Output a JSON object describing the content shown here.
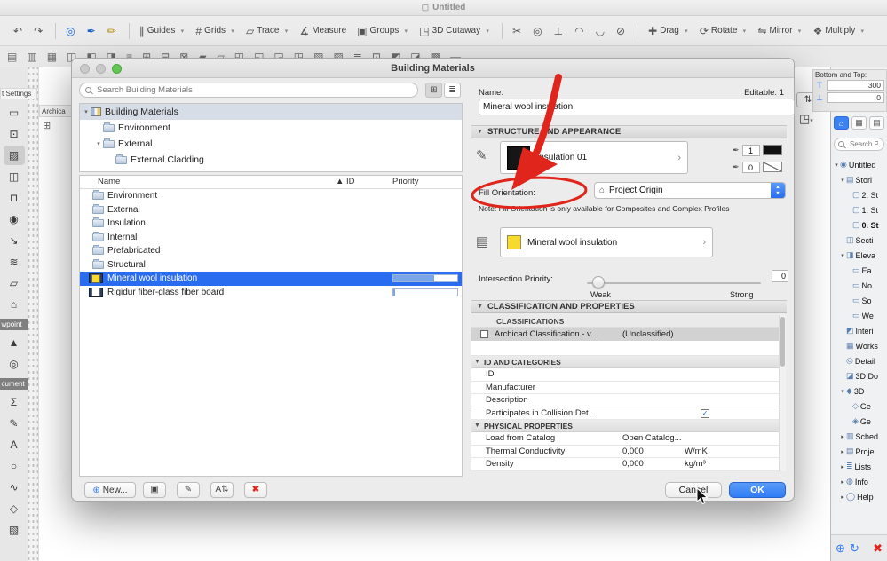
{
  "screen": {
    "title": "Untitled",
    "title_icon": "▢"
  },
  "toolbar1": {
    "items": [
      {
        "glyph": "↶",
        "name": "undo"
      },
      {
        "glyph": "↷",
        "name": "redo"
      },
      {
        "sep": true
      },
      {
        "glyph": "◎",
        "name": "pick-up-parameters",
        "color": "#1b66c9"
      },
      {
        "glyph": "✒",
        "name": "inject-parameters",
        "color": "#1b66c9"
      },
      {
        "glyph": "✏",
        "name": "favorites-pen",
        "color": "#b8920f"
      },
      {
        "sep": true
      },
      {
        "glyph": "∥",
        "label": "Guides",
        "chev": "▾"
      },
      {
        "glyph": "#",
        "label": "Grids",
        "chev": "▾"
      },
      {
        "glyph": "▱",
        "label": "Trace",
        "chev": "▾"
      },
      {
        "glyph": "∡",
        "label": "Measure"
      },
      {
        "glyph": "▣",
        "label": "Groups",
        "chev": "▾"
      },
      {
        "glyph": "◳",
        "label": "3D Cutaway",
        "chev": "▾"
      },
      {
        "sep": true
      },
      {
        "glyph": "✂",
        "name": "split"
      },
      {
        "glyph": "◎",
        "name": "adjust"
      },
      {
        "glyph": "⊥",
        "name": "intersect"
      },
      {
        "glyph": "◠",
        "name": "fillet"
      },
      {
        "glyph": "◡",
        "name": "chamfer"
      },
      {
        "glyph": "⊘",
        "name": "trim"
      },
      {
        "sep": true
      },
      {
        "glyph": "✚",
        "label": "Drag",
        "chev": "▾"
      },
      {
        "glyph": "⟳",
        "label": "Rotate",
        "chev": "▾"
      },
      {
        "glyph": "⇋",
        "label": "Mirror",
        "chev": "▾"
      },
      {
        "glyph": "❖",
        "label": "Multiply",
        "chev": "▾"
      }
    ]
  },
  "toolbar2": {
    "icons": [
      "▤",
      "▥",
      "▦",
      "◫",
      "◧",
      "◨",
      "≡",
      "⊞",
      "⊟",
      "⊠",
      "▰",
      "▱",
      "◰",
      "◱",
      "◲",
      "◳",
      "▧",
      "▨",
      "≣",
      "⊡",
      "◩",
      "◪",
      "▩",
      "▬"
    ]
  },
  "left_strip": {
    "settings_label": "t Settings",
    "palette_title": "Archica",
    "palette_icon": "⊞",
    "tools": [
      {
        "glyph": "▭",
        "name": "marquee-tool"
      },
      {
        "glyph": "⊡",
        "name": "select-tool"
      },
      {
        "glyph": "▨",
        "name": "wall-tool",
        "selected": true
      },
      {
        "glyph": "◫",
        "name": "column-tool"
      },
      {
        "glyph": "⊓",
        "name": "door-tool"
      },
      {
        "glyph": "◉",
        "name": "window-tool"
      },
      {
        "glyph": "↘",
        "name": "skylight-tool"
      },
      {
        "glyph": "≋",
        "name": "beam-tool"
      },
      {
        "glyph": "▱",
        "name": "slab-tool"
      },
      {
        "glyph": "⌂",
        "name": "roof-tool"
      },
      {
        "header": true,
        "glyph": "wpoint"
      },
      {
        "glyph": "▲",
        "name": "marker-tool"
      },
      {
        "glyph": "◎",
        "name": "hotspot-tool"
      },
      {
        "header": true,
        "glyph": "cument"
      },
      {
        "glyph": "Σ",
        "name": "label-tool"
      },
      {
        "glyph": "✎",
        "name": "text-tool"
      },
      {
        "glyph": "A",
        "name": "dimension-tool"
      },
      {
        "glyph": "○",
        "name": "circle-tool"
      },
      {
        "glyph": "∿",
        "name": "spline-tool"
      },
      {
        "glyph": "◇",
        "name": "polygon-tool"
      },
      {
        "glyph": "▧",
        "name": "figure-tool"
      }
    ]
  },
  "dialog": {
    "title": "Building Materials",
    "search_placeholder": "Search Building Materials",
    "view_btn_tree": "⊞",
    "view_btn_list": "≣",
    "tree": [
      {
        "label": "Building Materials",
        "level": 0,
        "chev": "▾",
        "selected": true,
        "grid_icon": true
      },
      {
        "label": "Environment",
        "level": 1,
        "folder": true
      },
      {
        "label": "External",
        "level": 1,
        "chev": "▾",
        "folder": true
      },
      {
        "label": "External Cladding",
        "level": 2,
        "folder": true
      }
    ],
    "columns": {
      "name": "Name",
      "id": "▲ ID",
      "priority": "Priority"
    },
    "rows": [
      {
        "name": "Environment",
        "folder": true
      },
      {
        "name": "External",
        "folder": true
      },
      {
        "name": "Insulation",
        "folder": true
      },
      {
        "name": "Internal",
        "folder": true
      },
      {
        "name": "Prefabricated",
        "folder": true
      },
      {
        "name": "Structural",
        "folder": true
      },
      {
        "name": "Mineral wool insulation",
        "material": true,
        "selected": true,
        "chip": "#f8da2f",
        "bar": "64%"
      },
      {
        "name": "Rigidur fiber-glass fiber board",
        "material": true,
        "chip": "#ffffff",
        "bar": "3%"
      }
    ],
    "footer": {
      "new_label": "New...",
      "plus_glyph": "⊕",
      "buttons": [
        {
          "glyph": "▣",
          "name": "duplicate"
        },
        {
          "glyph": "✎",
          "name": "rename"
        },
        {
          "glyph": "A⇅",
          "name": "sort"
        },
        {
          "glyph": "✖",
          "name": "delete",
          "danger": true
        }
      ]
    },
    "props": {
      "name_label": "Name:",
      "editable": "Editable: 1",
      "name_value": "Mineral wool insulation",
      "structure_header": "STRUCTURE AND APPEARANCE",
      "cut_fill_label": "insulation 01",
      "chevron_glyph": "›",
      "pens": [
        {
          "value": "1"
        },
        {
          "value": "0"
        }
      ],
      "fill_orientation_label": "Fill Orientation:",
      "fill_orientation_value": "Project Origin",
      "note": "Note: Fill Orientation is only available for Composites and Complex Profiles",
      "surface_label": "Mineral wool insulation",
      "surface_swatch": "#f8da2f",
      "intersection_label": "Intersection Priority:",
      "weak": "Weak",
      "strong": "Strong",
      "intersection_value": "0",
      "classification_header": "CLASSIFICATION AND PROPERTIES",
      "classifications_sub": "CLASSIFICATIONS",
      "classification_row": {
        "label": "Archicad Classification - v...",
        "value": "(Unclassified)"
      },
      "id_header": "ID AND CATEGORIES",
      "id_rows": [
        {
          "label": "ID"
        },
        {
          "label": "Manufacturer"
        },
        {
          "label": "Description"
        },
        {
          "label": "Participates in Collision Det...",
          "checked": true
        }
      ],
      "physical_header": "PHYSICAL PROPERTIES",
      "physical_rows": [
        {
          "label": "Load from Catalog",
          "value": "Open Catalog...",
          "unit": ""
        },
        {
          "label": "Thermal Conductivity",
          "value": "0,000",
          "unit": "W/mK"
        },
        {
          "label": "Density",
          "value": "0,000",
          "unit": "kg/m³"
        }
      ],
      "cancel": "Cancel",
      "ok": "OK"
    }
  },
  "navigator": {
    "bottom_top_label": "Bottom and Top:",
    "top_icon": "⊤",
    "bottom_icon": "⊥",
    "top_value": "300",
    "bottom_value": "0",
    "collapse_icon": "⇅",
    "cutaway_icon": "◳",
    "cutaway_chev": "▾",
    "toolbar_icons": [
      {
        "glyph": "⌂",
        "name": "project-chooser",
        "selected": true
      },
      {
        "glyph": "▦",
        "name": "view-map"
      },
      {
        "glyph": "▤",
        "name": "layout-book"
      }
    ],
    "search_placeholder": "Search P",
    "tree": [
      {
        "label": "Untitled",
        "level": 0,
        "chev": "▾",
        "glyph": "◉"
      },
      {
        "label": "Stori",
        "level": 1,
        "chev": "▾",
        "glyph": "▤"
      },
      {
        "label": "2. St",
        "level": 2,
        "glyph": "▢"
      },
      {
        "label": "1. St",
        "level": 2,
        "glyph": "▢"
      },
      {
        "label": "0. St",
        "level": 2,
        "glyph": "▢",
        "bold": true
      },
      {
        "label": "Secti",
        "level": 1,
        "glyph": "◫"
      },
      {
        "label": "Eleva",
        "level": 1,
        "chev": "▾",
        "glyph": "◨"
      },
      {
        "label": "Ea",
        "level": 2,
        "glyph": "▭"
      },
      {
        "label": "No",
        "level": 2,
        "glyph": "▭"
      },
      {
        "label": "So",
        "level": 2,
        "glyph": "▭"
      },
      {
        "label": "We",
        "level": 2,
        "glyph": "▭"
      },
      {
        "label": "Interi",
        "level": 1,
        "glyph": "◩"
      },
      {
        "label": "Works",
        "level": 1,
        "glyph": "▦"
      },
      {
        "label": "Detail",
        "level": 1,
        "glyph": "◎"
      },
      {
        "label": "3D Do",
        "level": 1,
        "glyph": "◪"
      },
      {
        "label": "3D",
        "level": 1,
        "chev": "▾",
        "glyph": "◆"
      },
      {
        "label": "Ge",
        "level": 2,
        "glyph": "◇"
      },
      {
        "label": "Ge",
        "level": 2,
        "glyph": "◈"
      },
      {
        "label": "Sched",
        "level": 1,
        "chev": "▸",
        "glyph": "▥"
      },
      {
        "label": "Proje",
        "level": 1,
        "chev": "▸",
        "glyph": "▤"
      },
      {
        "label": "Lists",
        "level": 1,
        "chev": "▸",
        "glyph": "≣"
      },
      {
        "label": "Info",
        "level": 1,
        "chev": "▸",
        "glyph": "◍"
      },
      {
        "label": "Help",
        "level": 1,
        "chev": "▸",
        "glyph": "◯"
      }
    ],
    "footer_icons": [
      {
        "glyph": "⊕",
        "name": "add-view",
        "color": "#2f7cf6"
      },
      {
        "glyph": "↻",
        "name": "refresh",
        "color": "#2f7cf6"
      },
      {
        "glyph": "✖",
        "name": "close-panel",
        "color": "#e0261c"
      }
    ]
  },
  "annotation": {
    "color": "#e0261c"
  }
}
